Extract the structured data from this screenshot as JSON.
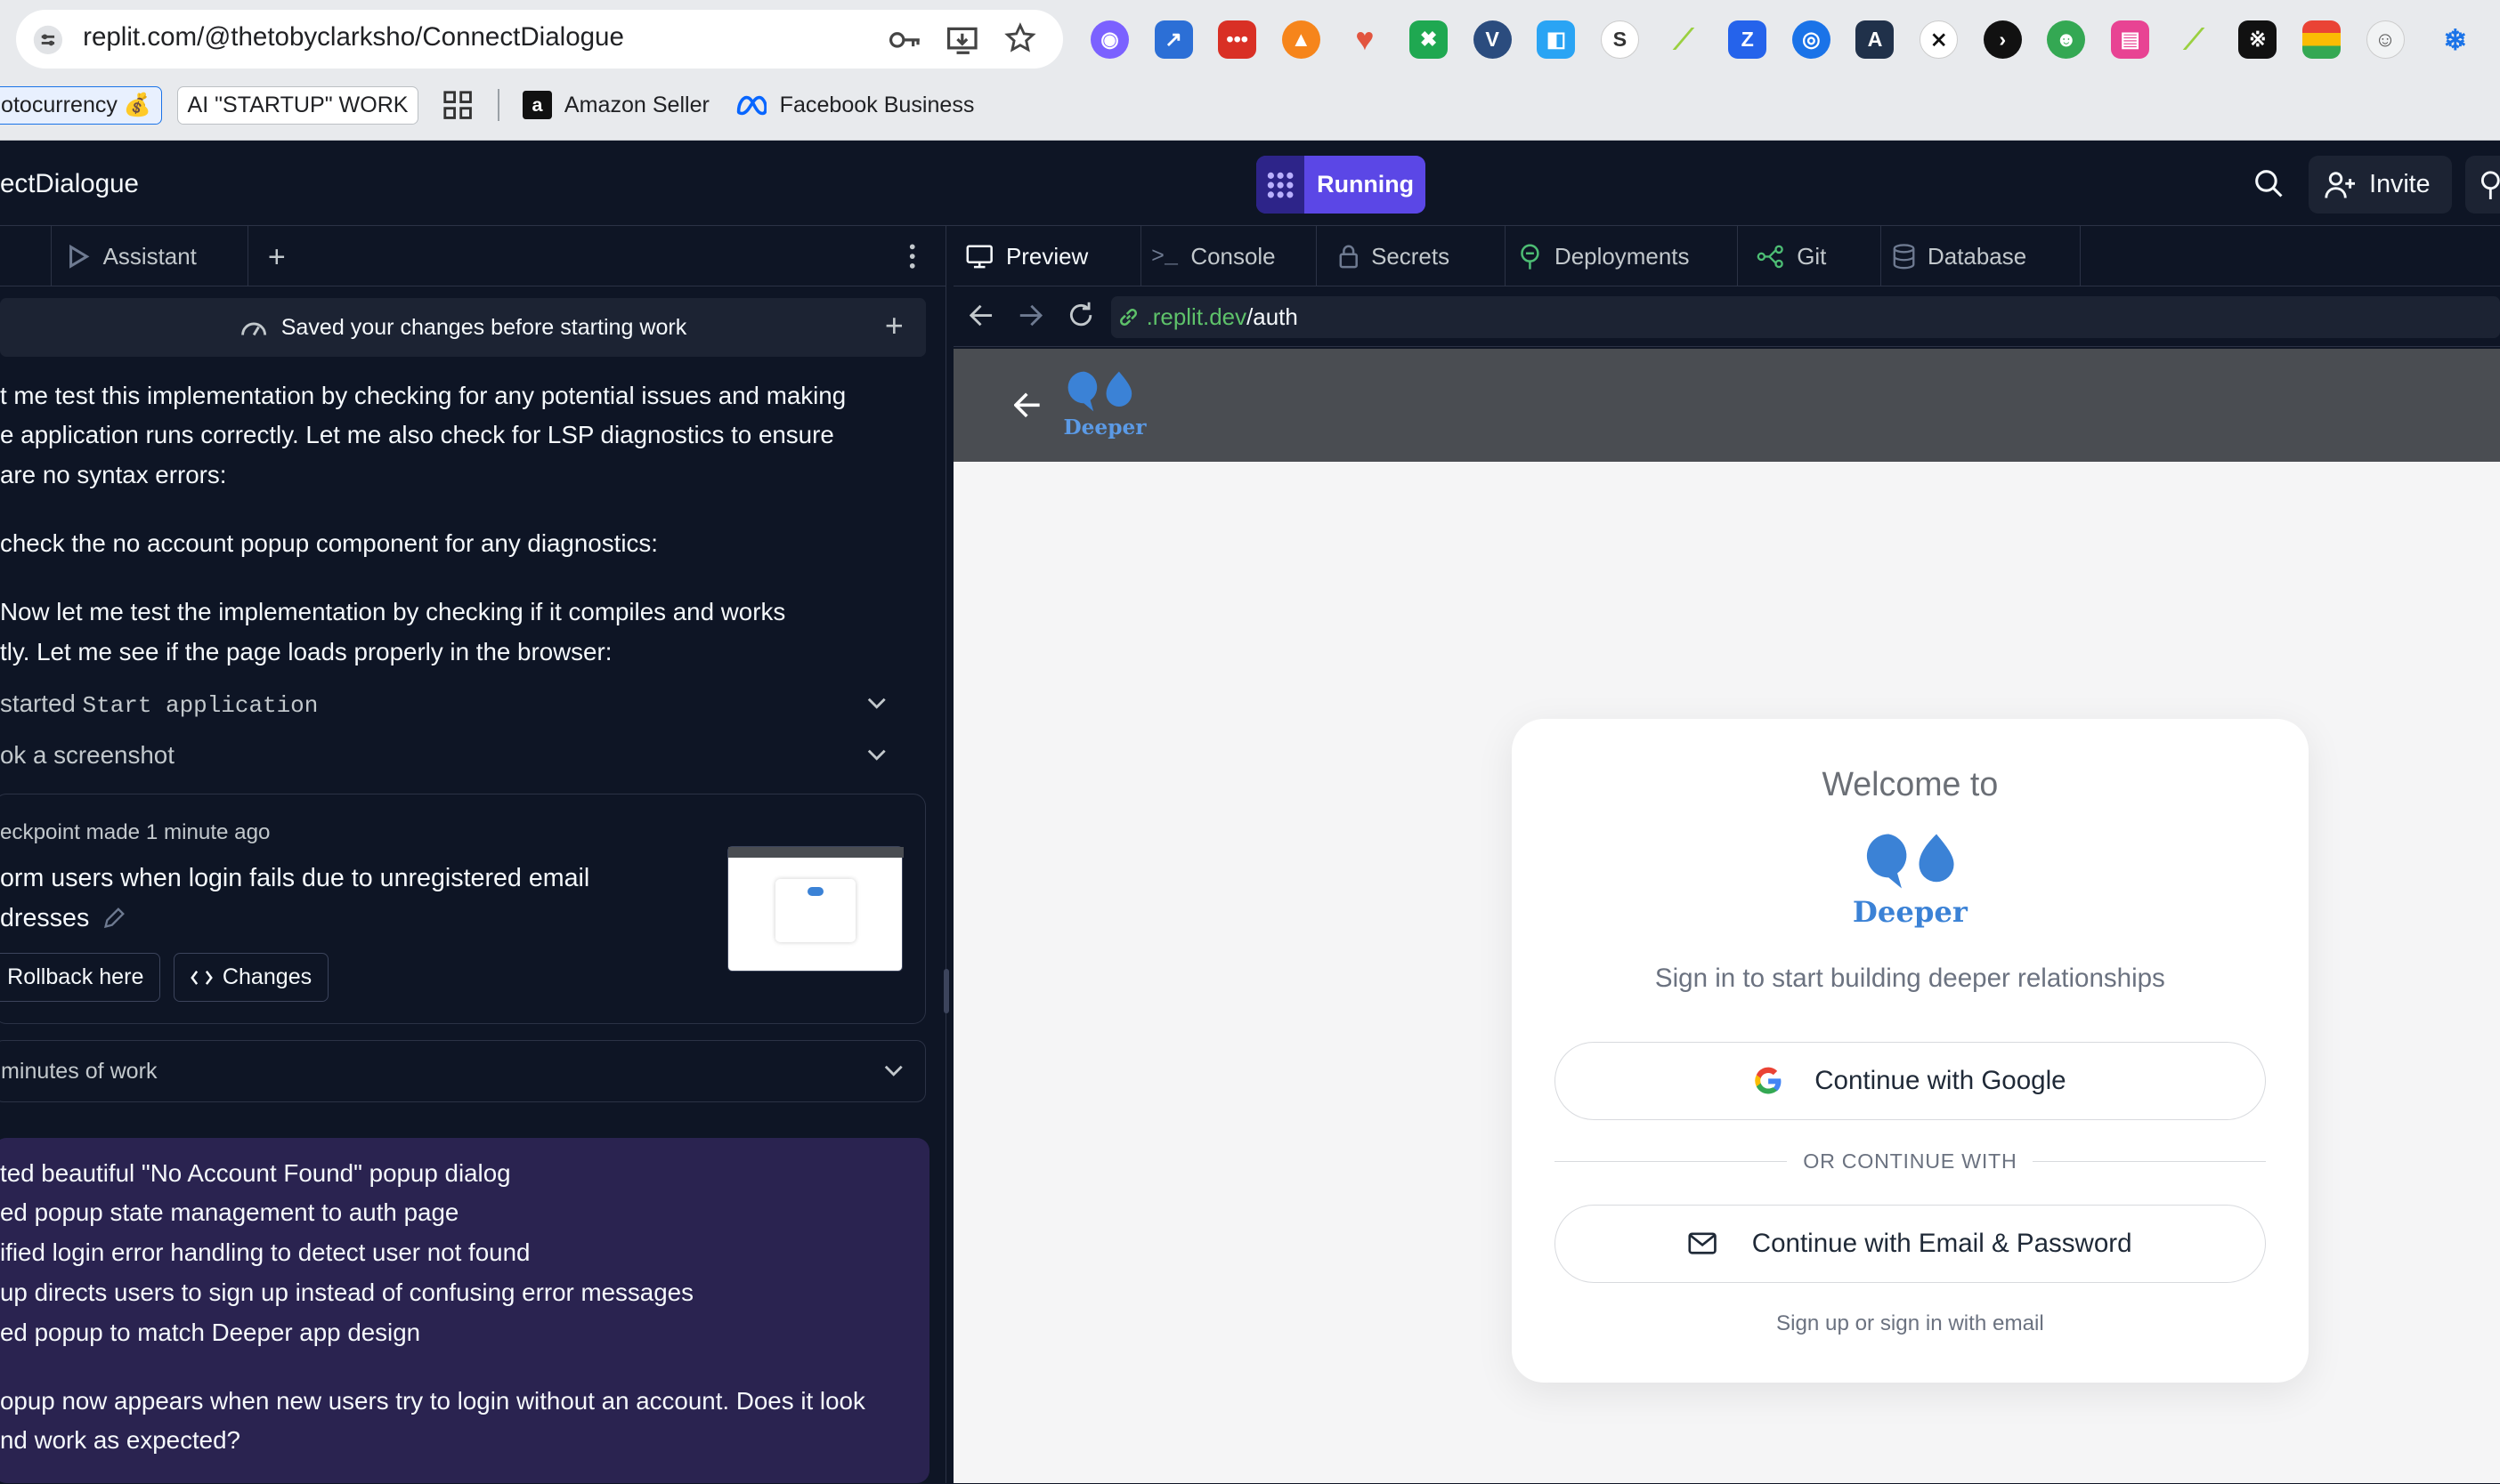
{
  "browser": {
    "url": "replit.com/@thetobyclarksho/ConnectDialogue",
    "bookmarks": {
      "crypto": "otocurrency 💰",
      "startup": "AI \"STARTUP\" WORK",
      "amazon": "Amazon Seller",
      "facebook": "Facebook Business"
    }
  },
  "replit": {
    "project_title": "ectDialogue",
    "run_status": "Running",
    "invite_label": "Invite"
  },
  "left_panel": {
    "tab_assistant": "Assistant",
    "saved_notice": "Saved your changes before starting work",
    "messages": [
      "t me test this implementation by checking for any potential issues and making",
      "e application runs correctly. Let me also check for LSP diagnostics to ensure",
      "are no syntax errors:",
      " check the no account popup component for any diagnostics:",
      "Now let me test the implementation by checking if it compiles and works",
      "tly. Let me see if the page loads properly in the browser:"
    ],
    "event_started_prefix": "started ",
    "event_started_code": "Start application",
    "event_screenshot": "ok a screenshot",
    "checkpoint": {
      "meta": "eckpoint made 1 minute ago",
      "title_line1": "orm users when login fails due to unregistered email",
      "title_line2": "dresses",
      "rollback": "Rollback here",
      "changes": "Changes"
    },
    "work_summary": "minutes of work",
    "summary_lines": [
      "ted beautiful \"No Account Found\" popup dialog",
      "ed popup state management to auth page",
      "ified login error handling to detect user not found",
      "up directs users to sign up instead of confusing error messages",
      "ed popup to match Deeper app design"
    ],
    "summary_question_1": "opup now appears when new users try to login without an account. Does it look",
    "summary_question_2": "nd work as expected?"
  },
  "right_panel": {
    "tabs": [
      "Preview",
      "Console",
      "Secrets",
      "Deployments",
      "Git",
      "Database"
    ],
    "url_domain": ".replit.dev",
    "url_path": "/auth"
  },
  "auth_page": {
    "brand": "Deeper",
    "welcome": "Welcome to",
    "brand_big": "Deeper",
    "subtitle": "Sign in to start building deeper relationships",
    "google_button": "Continue with Google",
    "divider_text": "OR CONTINUE WITH",
    "email_button": "Continue with Email & Password",
    "footer_note": "Sign up or sign in with email"
  },
  "colors": {
    "replit_bg": "#0e1525",
    "running_purple": "#5b47e6",
    "summary_bg": "#2a2350",
    "brand_blue": "#3b82d6",
    "url_green": "#5ec26a"
  }
}
